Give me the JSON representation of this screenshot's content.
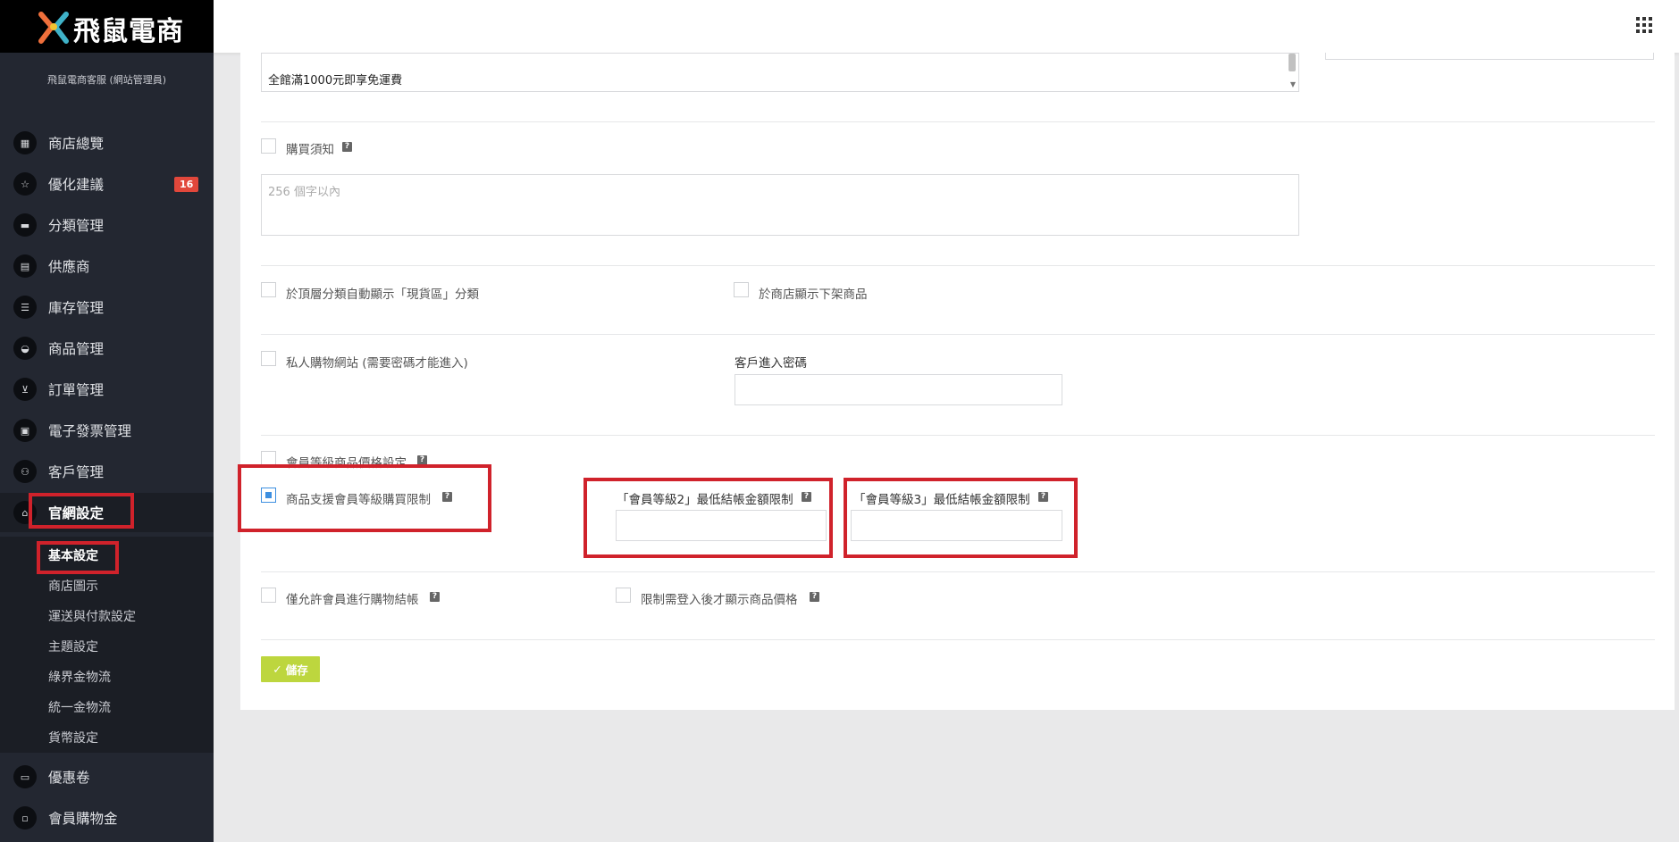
{
  "app": {
    "logo_text": "飛鼠電商",
    "user": "飛鼠電商客服 (網站管理員)"
  },
  "sidebar": {
    "items": [
      {
        "label": "商店總覽",
        "icon": "dashboard-icon"
      },
      {
        "label": "優化建議",
        "icon": "star-icon",
        "badge": "16"
      },
      {
        "label": "分類管理",
        "icon": "folder-icon"
      },
      {
        "label": "供應商",
        "icon": "store-icon"
      },
      {
        "label": "庫存管理",
        "icon": "list-icon"
      },
      {
        "label": "商品管理",
        "icon": "basket-icon"
      },
      {
        "label": "訂單管理",
        "icon": "cart-icon"
      },
      {
        "label": "電子發票管理",
        "icon": "document-icon"
      },
      {
        "label": "客戶管理",
        "icon": "users-icon"
      },
      {
        "label": "官網設定",
        "icon": "home-icon"
      },
      {
        "label": "優惠卷",
        "icon": "ticket-icon"
      },
      {
        "label": "會員購物金",
        "icon": "money-icon"
      }
    ],
    "subitems": [
      "基本設定",
      "商店圖示",
      "運送與付款設定",
      "主題設定",
      "綠界金物流",
      "統一金物流",
      "貨幣設定"
    ]
  },
  "form": {
    "top_textarea_line1": "全館滿1000元即享免運費",
    "purchase_notice_label": "購買須知",
    "purchase_notice_placeholder": "256 個字以內",
    "show_instock_label": "於頂層分類自動顯示「現貨區」分類",
    "show_unlisted_label": "於商店顯示下架商品",
    "private_store_label": "私人購物網站 (需要密碼才能進入)",
    "customer_password_label": "客戶進入密碼",
    "member_price_label": "會員等級商品價格設定",
    "member_restriction_label": "商品支援會員等級購買限制",
    "level2_min_label": "「會員等級2」最低結帳金額限制",
    "level3_min_label": "「會員等級3」最低結帳金額限制",
    "members_only_checkout_label": "僅允許會員進行購物結帳",
    "login_price_label": "限制需登入後才顯示商品價格",
    "save_label": "儲存"
  }
}
